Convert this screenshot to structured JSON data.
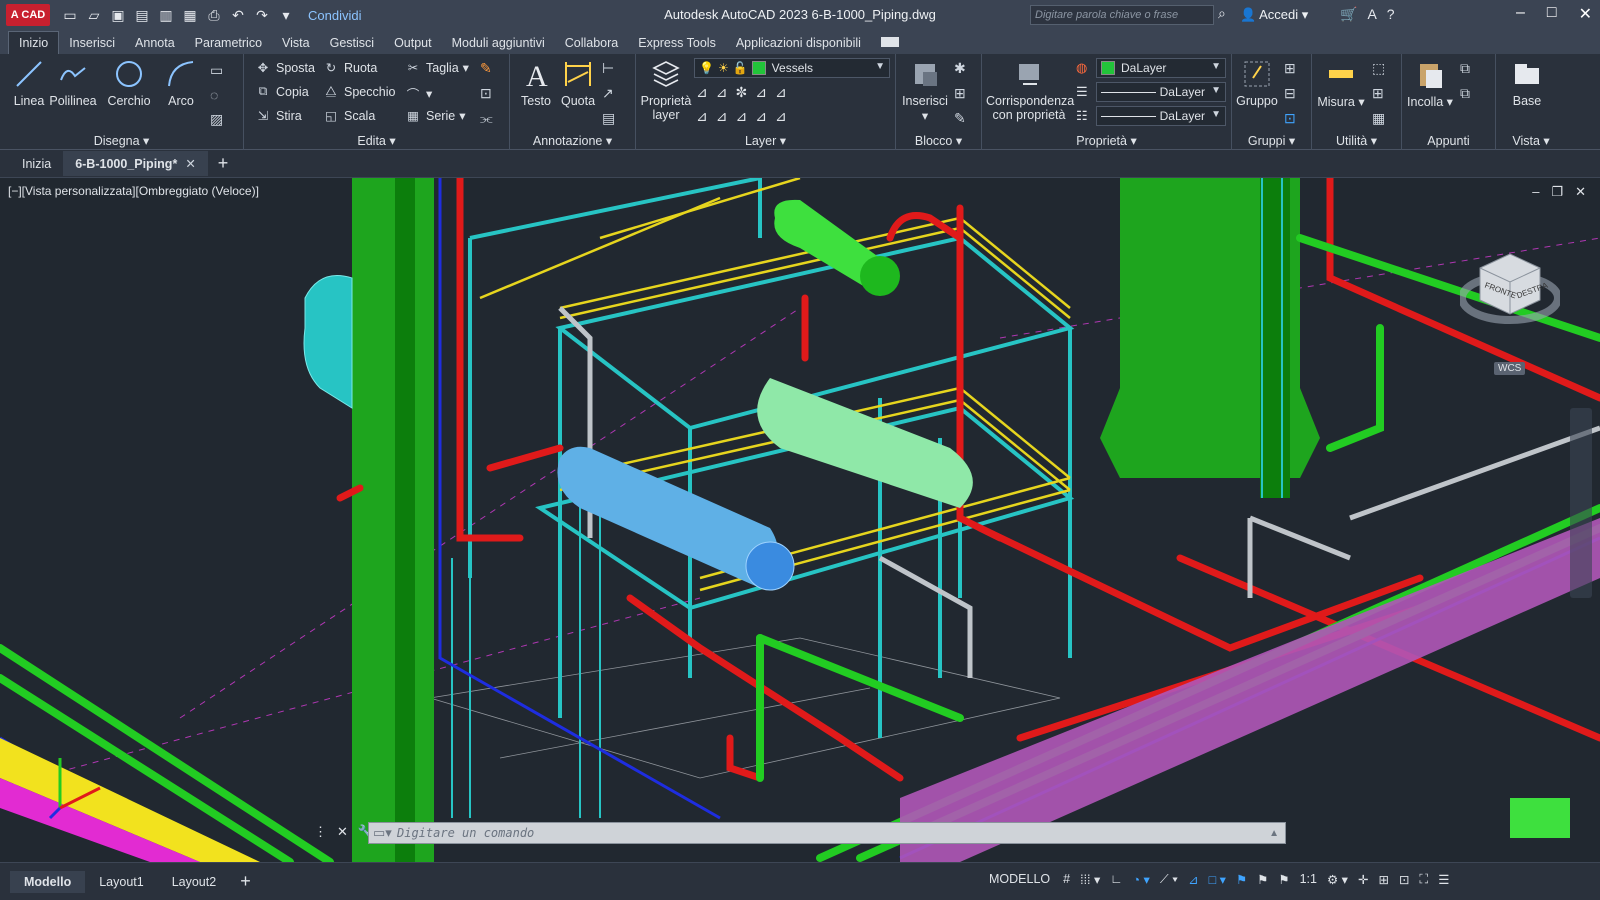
{
  "titlebar": {
    "logo": "A CAD",
    "share_label": "Condividi",
    "title": "Autodesk AutoCAD 2023    6-B-1000_Piping.dwg",
    "search_placeholder": "Digitare parola chiave o frase",
    "signin_label": "Accedi",
    "qat_icons": [
      "new-icon",
      "open-icon",
      "save-icon",
      "saveas-icon",
      "publish-icon",
      "plot-icon",
      "print-icon",
      "undo-icon",
      "redo-icon",
      "dropdown-icon"
    ]
  },
  "ribbon_tabs": [
    "Inizio",
    "Inserisci",
    "Annota",
    "Parametrico",
    "Vista",
    "Gestisci",
    "Output",
    "Moduli aggiuntivi",
    "Collabora",
    "Express Tools",
    "Applicazioni disponibili"
  ],
  "ribbon": {
    "draw": {
      "line": "Linea",
      "polyline": "Polilinea",
      "circle": "Cerchio",
      "arc": "Arco",
      "label": "Disegna"
    },
    "modify": {
      "move": "Sposta",
      "rotate": "Ruota",
      "trim": "Taglia",
      "copy": "Copia",
      "mirror": "Specchio",
      "stretch": "Stira",
      "scale": "Scala",
      "array": "Serie",
      "label": "Edita"
    },
    "annotation": {
      "text": "Testo",
      "dim": "Quota",
      "label": "Annotazione"
    },
    "layers": {
      "props_line1": "Proprietà",
      "props_line2": "layer",
      "current_layer": "Vessels",
      "label": "Layer"
    },
    "block": {
      "insert": "Inserisci",
      "label": "Blocco"
    },
    "properties": {
      "match_line1": "Corrispondenza",
      "match_line2": "con proprietà",
      "color": "DaLayer",
      "linetype": "DaLayer",
      "lineweight": "DaLayer",
      "label": "Proprietà"
    },
    "groups": {
      "group": "Gruppo",
      "label": "Gruppi"
    },
    "utilities": {
      "measure": "Misura",
      "label": "Utilità"
    },
    "clipboard": {
      "paste": "Incolla",
      "label": "Appunti"
    },
    "view": {
      "base": "Base",
      "label": "Vista"
    }
  },
  "doc_tabs": {
    "start": "Inizia",
    "file": "6-B-1000_Piping*"
  },
  "viewport": {
    "label": "[−][Vista personalizzata][Ombreggiato (Veloce)]",
    "viewcube_front": "FRONTE",
    "viewcube_right": "DESTRA",
    "wcs": "WCS"
  },
  "command": {
    "placeholder": "Digitare un comando"
  },
  "status": {
    "layouts": [
      "Modello",
      "Layout1",
      "Layout2"
    ],
    "mode": "MODELLO",
    "scale": "1:1"
  },
  "colors": {
    "accent": "#3fa4ff",
    "bg": "#212830",
    "ribbon": "#2a313c"
  }
}
